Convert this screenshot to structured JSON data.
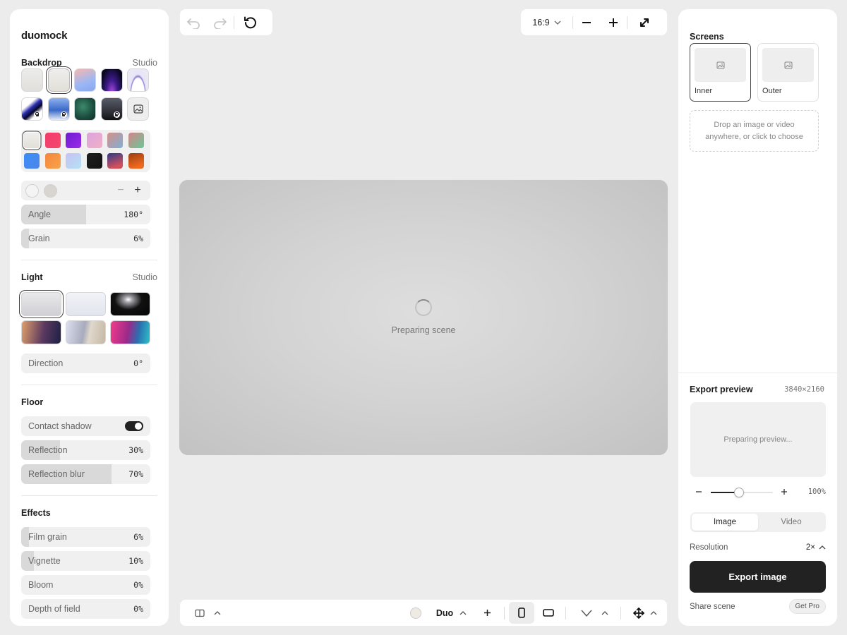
{
  "app": {
    "name": "duomock"
  },
  "backdrop": {
    "title": "Backdrop",
    "mode": "Studio",
    "presets": [
      {
        "name": "plain-light",
        "bg": "linear-gradient(#ececea,#e0dfdc)",
        "locked": false,
        "selected": false
      },
      {
        "name": "warm-light",
        "bg": "linear-gradient(#efeeec,#e2dfd9)",
        "locked": false,
        "selected": true
      },
      {
        "name": "pastel",
        "bg": "linear-gradient(160deg,#f6b7b0,#9bb7f4 60%,#8aa6f0)",
        "locked": false,
        "selected": false
      },
      {
        "name": "night",
        "bg": "radial-gradient(ellipse at 50% 110%,#b14fe0 0%,#3c1a8a 40%,#090820 80%)",
        "locked": false,
        "selected": false
      },
      {
        "name": "arc",
        "bg": "radial-gradient(ellipse at 50% 115%,#fff 45%,#8a7ed9 50%,#e8e6f5 56%,#eceaf7 100%)",
        "locked": false,
        "selected": false
      },
      {
        "name": "wave",
        "bg": "linear-gradient(140deg,#fff 0%,#fff 30%,#2b2fae 45%,#050628 60%,#fff 75%)",
        "locked": true,
        "selected": false
      },
      {
        "name": "sky",
        "bg": "linear-gradient(#8fb3ef,#3a69c8 55%,#e6ecf7 100%)",
        "locked": true,
        "selected": false
      },
      {
        "name": "forest",
        "bg": "radial-gradient(circle at 40% 40%,#3c8a6c,#1c4c3e 60%,#0f2f27)",
        "locked": false,
        "selected": false
      },
      {
        "name": "dusk",
        "bg": "linear-gradient(#595c68,#2a2b33 70%,#111)",
        "locked": true,
        "selected": false
      }
    ],
    "colors": [
      {
        "c": "linear-gradient(#efeeec,#e2dfd9)",
        "selected": true
      },
      {
        "c": "linear-gradient(135deg,#f23a6a,#f5486f)",
        "selected": false
      },
      {
        "c": "linear-gradient(135deg,#6e1bd1,#9b2de8)",
        "selected": false
      },
      {
        "c": "linear-gradient(135deg,#dca3dc,#f0b0c8)",
        "selected": false
      },
      {
        "c": "linear-gradient(135deg,#d58f88,#7fb0d4)",
        "selected": false
      },
      {
        "c": "linear-gradient(135deg,#d6838a,#69c896)",
        "selected": false
      },
      {
        "c": "linear-gradient(135deg,#3a8ef6,#4d86ea)",
        "selected": false
      },
      {
        "c": "linear-gradient(135deg,#f6853d,#f6a44a)",
        "selected": false
      },
      {
        "c": "linear-gradient(135deg,#c7c1f5,#b4e2f4)",
        "selected": false
      },
      {
        "c": "linear-gradient(135deg,#1e1e1e,#111)",
        "selected": false
      },
      {
        "c": "linear-gradient(160deg,#2d3a8a,#d3505b 80%)",
        "selected": false
      },
      {
        "c": "linear-gradient(160deg,#9a3d0f,#f06a20 80%)",
        "selected": false
      }
    ],
    "stops": [
      "#f4f4f4",
      "#d8d5d0"
    ],
    "angle": {
      "label": "Angle",
      "value": "180°",
      "fill": 0.5
    },
    "grain": {
      "label": "Grain",
      "value": "6%",
      "fill": 0.06
    }
  },
  "light": {
    "title": "Light",
    "mode": "Studio",
    "presets": [
      {
        "bg": "linear-gradient(#e9e9ec,#cfcfd4)",
        "selected": true
      },
      {
        "bg": "linear-gradient(#f2f3f7,#e2e4ee)",
        "selected": false
      },
      {
        "bg": "radial-gradient(ellipse at 45% 30%,#fff 0%,#9d9da3 14%,#111 45%,#050505 100%)",
        "selected": false
      },
      {
        "bg": "linear-gradient(100deg,#e1a06a,#5b3960 55%,#1d2045)",
        "selected": false
      },
      {
        "bg": "linear-gradient(100deg,#dcdff0,#a8abbb 45%,#e0d8cc 60%,#c5b8a4)",
        "selected": false
      },
      {
        "bg": "linear-gradient(100deg,#f43b8b,#9a2a8a 45%,#2a6fb0 70%,#2ec2c8)",
        "selected": false
      }
    ],
    "direction": {
      "label": "Direction",
      "value": "0°",
      "fill": 0.0
    }
  },
  "floor": {
    "title": "Floor",
    "contact_shadow": {
      "label": "Contact shadow",
      "on": true
    },
    "reflection": {
      "label": "Reflection",
      "value": "30%",
      "fill": 0.3
    },
    "reflection_blur": {
      "label": "Reflection blur",
      "value": "70%",
      "fill": 0.7
    }
  },
  "effects": {
    "title": "Effects",
    "film_grain": {
      "label": "Film grain",
      "value": "6%",
      "fill": 0.06
    },
    "vignette": {
      "label": "Vignette",
      "value": "10%",
      "fill": 0.1
    },
    "bloom": {
      "label": "Bloom",
      "value": "0%",
      "fill": 0.0
    },
    "depth_of_field": {
      "label": "Depth of field",
      "value": "0%",
      "fill": 0.0
    }
  },
  "top_toolbar": {
    "aspect": "16:9"
  },
  "stage": {
    "status": "Preparing scene"
  },
  "bottom_toolbar": {
    "mode": "Duo",
    "device_color": "#efebe3"
  },
  "screens": {
    "title": "Screens",
    "items": [
      {
        "label": "Inner",
        "selected": true
      },
      {
        "label": "Outer",
        "selected": false
      }
    ],
    "drop_line1": "Drop an image or video",
    "drop_line2": "anywhere, or click to choose"
  },
  "export": {
    "title": "Export preview",
    "size": "3840×2160",
    "preview_status": "Preparing preview...",
    "zoom": "100%",
    "zoom_fill": 0.46,
    "tabs": [
      {
        "label": "Image",
        "selected": true
      },
      {
        "label": "Video",
        "selected": false
      }
    ],
    "resolution_label": "Resolution",
    "resolution_value": "2×",
    "button": "Export image",
    "share": "Share scene",
    "pro": "Get Pro"
  }
}
